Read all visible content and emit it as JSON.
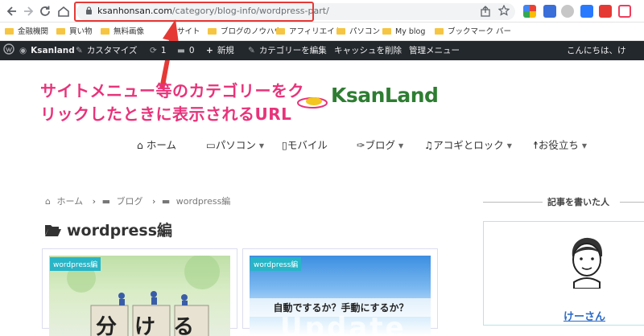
{
  "browser": {
    "url_host": "ksanhonsan.com",
    "url_path": "/category/blog-info/wordpress-part/"
  },
  "bookmarks": [
    "金融機関",
    "買い物",
    "無料画像",
    "サイト",
    "ブログのノウハウ",
    "アフィリエイト",
    "パソコン",
    "My blog",
    "ブックマーク バー"
  ],
  "adminbar": {
    "site": "Ksanland",
    "customize": "カスタマイズ",
    "updates": "1",
    "comments": "0",
    "new": "新規",
    "edit_category": "カテゴリーを編集",
    "clear_cache": "キャッシュを削除",
    "admin_menu": "管理メニュー",
    "greeting": "こんにちは、け"
  },
  "annotation": {
    "line1": "サイトメニュー等のカテゴリーをク",
    "line2": "リックしたときに表示されるURL"
  },
  "logo": {
    "text": "KsanLand"
  },
  "nav": {
    "home": "ホーム",
    "pc": "パソコン",
    "mobile": "モバイル",
    "blog": "ブログ",
    "guitar": "アコギとロック",
    "tips": "お役立ち"
  },
  "breadcrumb": {
    "home": "ホーム",
    "blog": "ブログ",
    "current": "wordpress編"
  },
  "page": {
    "title": "wordpress編"
  },
  "cards": [
    {
      "badge": "wordpress編",
      "thumb_text": "分ける"
    },
    {
      "badge": "wordpress編",
      "thumb_text": "自動でするか？手動にするか？",
      "bg_text": "Update"
    }
  ],
  "sidebar": {
    "title": "記事を書いた人",
    "author": "けーさん"
  },
  "colors": {
    "adminbar": "#23282d",
    "annotation": "#e8337a",
    "logo": "#2e7d32",
    "badge": "#28b5c7",
    "highlight": "#e53935"
  }
}
